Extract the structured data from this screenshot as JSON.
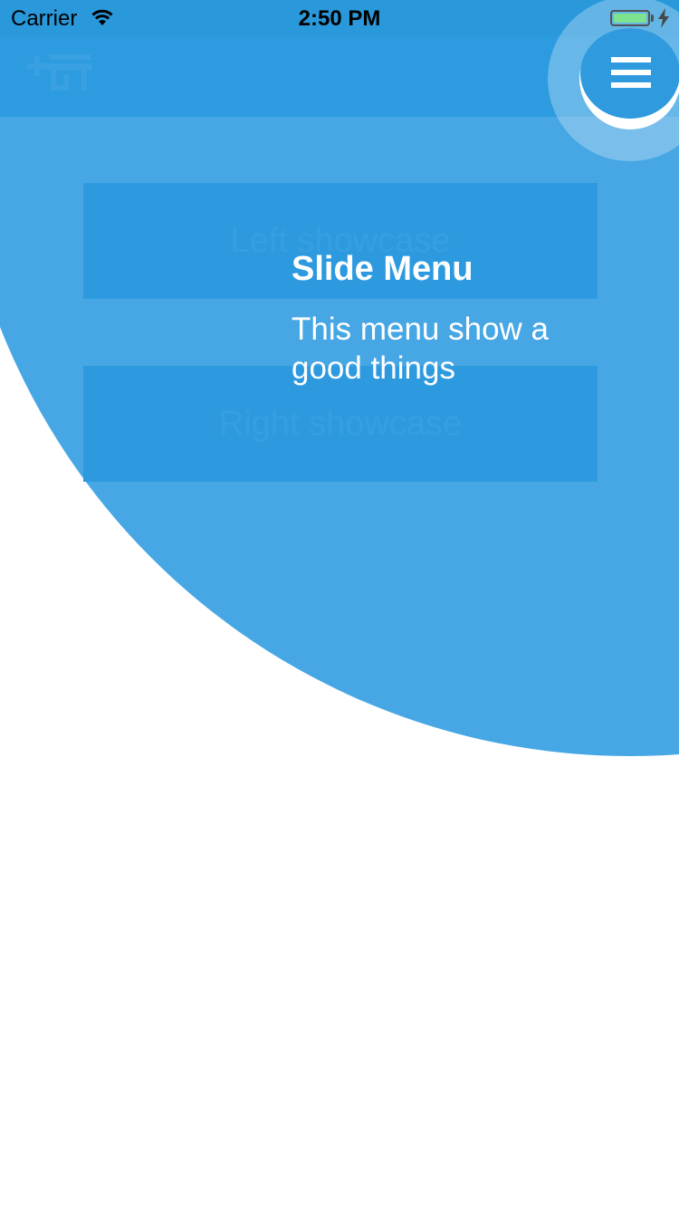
{
  "status_bar": {
    "carrier": "Carrier",
    "time": "2:50 PM",
    "wifi_icon": "wifi-icon",
    "battery_icon": "battery-icon",
    "charging_icon": "charging-bolt-icon",
    "battery_color": "#4CD964"
  },
  "nav_bar": {
    "left_icon": "add-shop-icon",
    "right_icon": "hamburger-menu-icon",
    "background": "#2999DC"
  },
  "main": {
    "left_showcase_label": "Left showcase",
    "right_showcase_label": "Right showcase"
  },
  "showcase_tooltip": {
    "title": "Slide Menu",
    "description": "This menu show a good things",
    "overlay_color": "#2E9BE0"
  }
}
